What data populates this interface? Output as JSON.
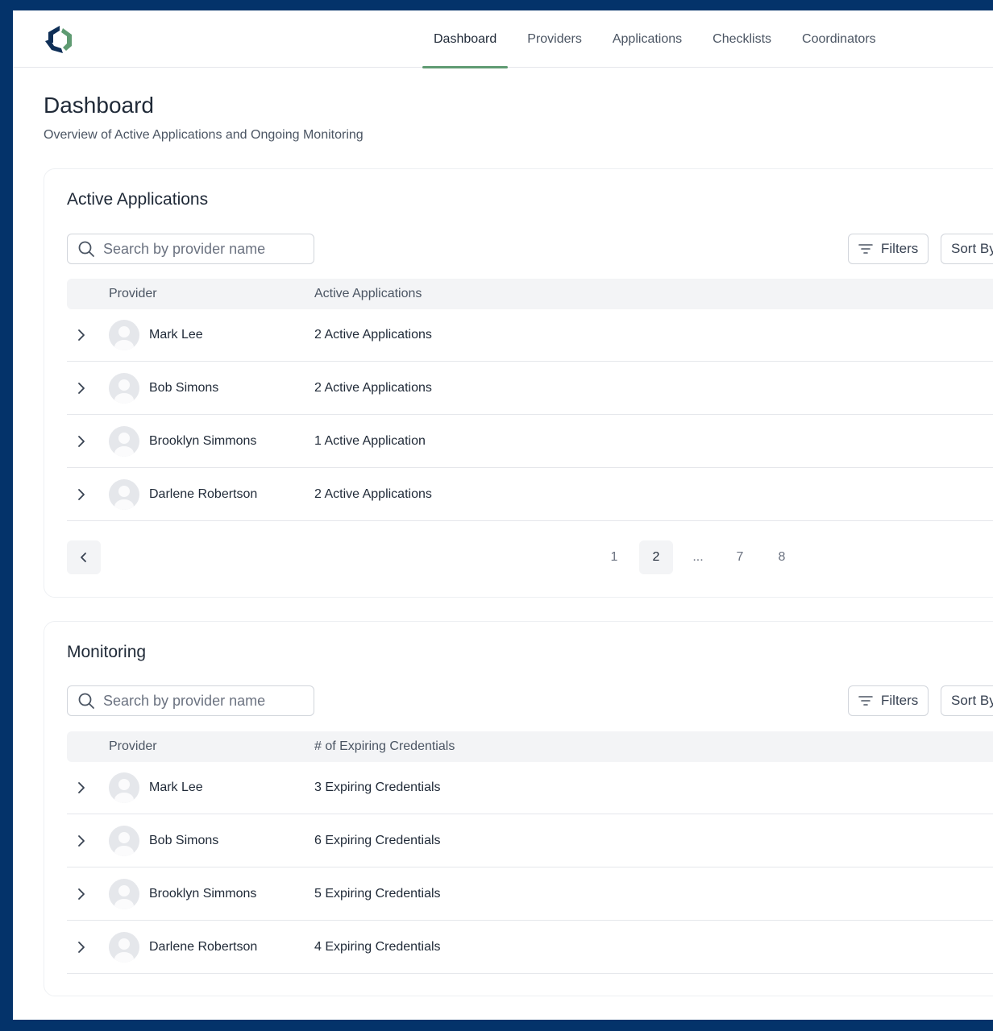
{
  "nav": {
    "items": [
      {
        "label": "Dashboard",
        "active": true
      },
      {
        "label": "Providers"
      },
      {
        "label": "Applications"
      },
      {
        "label": "Checklists"
      },
      {
        "label": "Coordinators"
      }
    ]
  },
  "page": {
    "title": "Dashboard",
    "subtitle": "Overview of Active Applications and Ongoing Monitoring"
  },
  "active_applications": {
    "title": "Active Applications",
    "search_placeholder": "Search by provider name",
    "filters_label": "Filters",
    "sort_label": "Sort By",
    "columns": [
      "Provider",
      "Active Applications"
    ],
    "rows": [
      {
        "provider": "Mark Lee",
        "value": "2 Active Applications"
      },
      {
        "provider": "Bob Simons",
        "value": "2 Active Applications"
      },
      {
        "provider": "Brooklyn Simmons",
        "value": "1 Active Application"
      },
      {
        "provider": "Darlene Robertson",
        "value": "2 Active Applications"
      }
    ],
    "pagination": {
      "pages": [
        "1",
        "2",
        "...",
        "7",
        "8"
      ],
      "current": "2"
    }
  },
  "monitoring": {
    "title": "Monitoring",
    "search_placeholder": "Search by provider name",
    "filters_label": "Filters",
    "sort_label": "Sort By",
    "columns": [
      "Provider",
      "# of Expiring Credentials"
    ],
    "rows": [
      {
        "provider": "Mark Lee",
        "value": "3 Expiring Credentials"
      },
      {
        "provider": "Bob Simons",
        "value": "6 Expiring Credentials"
      },
      {
        "provider": "Brooklyn Simmons",
        "value": "5 Expiring Credentials"
      },
      {
        "provider": "Darlene Robertson",
        "value": "4 Expiring Credentials"
      }
    ]
  },
  "colors": {
    "frame": "#04336a",
    "accent": "#5f9b72",
    "logo_navy": "#0f2f57",
    "logo_green": "#5f9b72"
  }
}
